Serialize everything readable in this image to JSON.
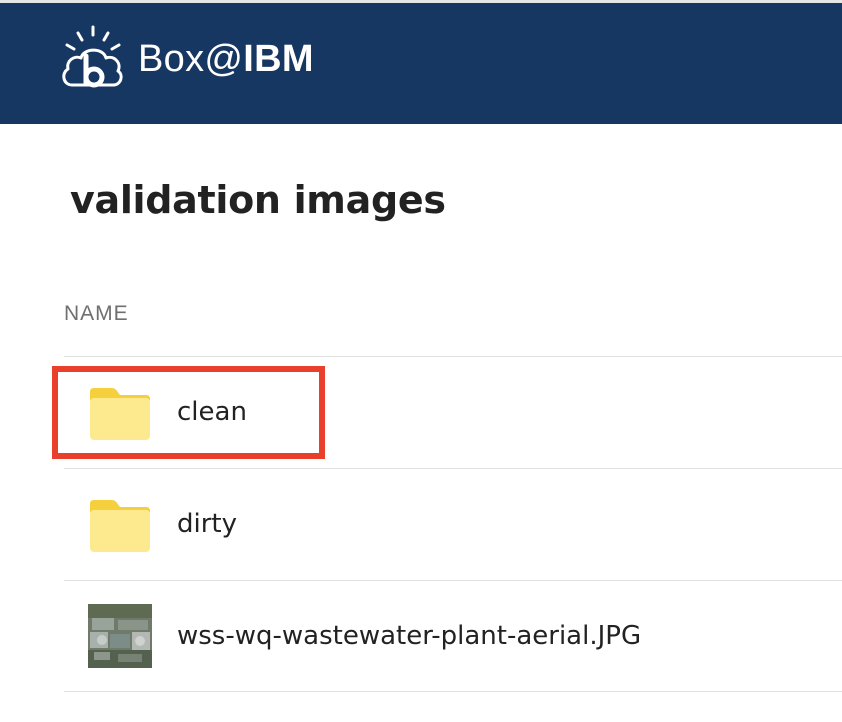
{
  "header": {
    "brand": "Box@",
    "org": "IBM",
    "background": "#173763"
  },
  "page": {
    "title": "validation images"
  },
  "table": {
    "column_name": "NAME",
    "items": [
      {
        "name": "clean",
        "type": "folder",
        "icon": "folder-icon"
      },
      {
        "name": "dirty",
        "type": "folder",
        "icon": "folder-icon"
      },
      {
        "name": "wss-wq-wastewater-plant-aerial.JPG",
        "type": "image",
        "icon": "image-thumbnail"
      }
    ]
  },
  "annotation": {
    "highlight_color": "#e8402a",
    "target": "clean"
  }
}
